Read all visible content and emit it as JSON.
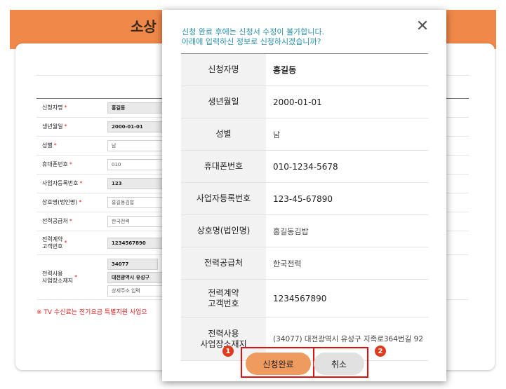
{
  "background": {
    "title_fragment": "소상",
    "form": [
      {
        "label": "신청자명",
        "value": "홍길동",
        "filled": true
      },
      {
        "label": "생년월일",
        "value": "2000-01-01",
        "filled": true
      },
      {
        "label": "성별",
        "value": "남",
        "filled": false
      },
      {
        "label": "휴대폰번호",
        "value": "010",
        "filled": false
      },
      {
        "label": "사업자등록번호",
        "value": "123",
        "filled": true
      },
      {
        "label": "상호명(법인명)",
        "value": "홍길동김밥",
        "filled": false
      },
      {
        "label": "전력공급처",
        "value": "한국전력",
        "filled": false
      },
      {
        "label": "전력계약\n고객번호",
        "value": "1234567890",
        "filled": true
      }
    ],
    "address_label": "전력사용\n사업장소재지",
    "address_postcode": "34077",
    "address_main": "대전광역시 유성구",
    "address_detail_placeholder": "상세주소 입력",
    "required_mark": "*",
    "note": "※ TV 수신료는 전기요금 특별지원 사업으"
  },
  "modal": {
    "message_line1": "신청 완료 후에는 신청서 수정이 불가합니다.",
    "message_line2": "아래에 입력하신 정보로 신청하시겠습니까?",
    "close_symbol": "✕",
    "rows": [
      {
        "key": "신청자명",
        "value": "홍길동"
      },
      {
        "key": "생년월일",
        "value": "2000-01-01"
      },
      {
        "key": "성별",
        "value": "남"
      },
      {
        "key": "휴대폰번호",
        "value": "010-1234-5678"
      },
      {
        "key": "사업자등록번호",
        "value": "123-45-67890"
      },
      {
        "key": "상호명(법인명)",
        "value": "홍길동김밥"
      },
      {
        "key": "전력공급처",
        "value": "한국전력"
      },
      {
        "key": "전력계약\n고객번호",
        "value": "1234567890"
      },
      {
        "key": "전력사용\n사업장소재지",
        "value": "(34077) 대전광역시 유성구 지족로364번길 92"
      }
    ],
    "submit_label": "신청완료",
    "cancel_label": "취소",
    "badge_1": "1",
    "badge_2": "2"
  }
}
